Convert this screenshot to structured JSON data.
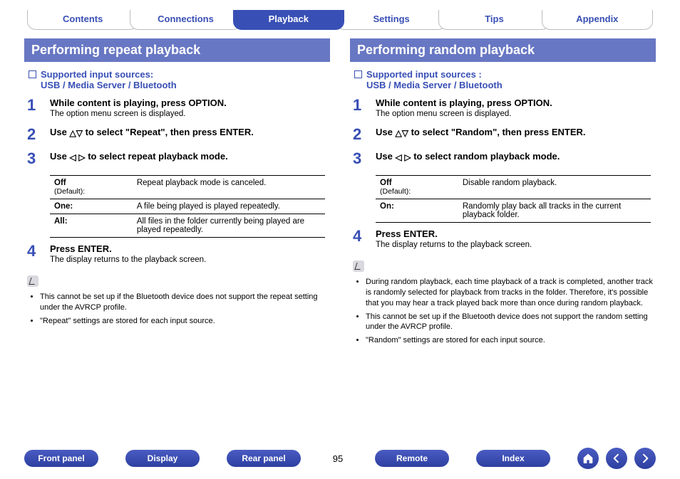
{
  "topnav": {
    "tabs": [
      {
        "label": "Contents",
        "active": false
      },
      {
        "label": "Connections",
        "active": false
      },
      {
        "label": "Playback",
        "active": true
      },
      {
        "label": "Settings",
        "active": false
      },
      {
        "label": "Tips",
        "active": false
      },
      {
        "label": "Appendix",
        "active": false
      }
    ]
  },
  "left": {
    "header": "Performing repeat playback",
    "sub": "Supported input sources:\nUSB / Media Server / Bluetooth",
    "steps": {
      "s1_title": "While content is playing, press OPTION.",
      "s1_note": "The option menu screen is displayed.",
      "s2_title_a": "Use ",
      "s2_title_b": " to select \"Repeat\", then press ENTER.",
      "s3_title_a": "Use ",
      "s3_title_b": " to select repeat playback mode.",
      "s4_title": "Press ENTER.",
      "s4_note": "The display returns to the playback screen."
    },
    "modes": [
      {
        "name": "Off",
        "default": "(Default):",
        "desc": "Repeat playback mode is canceled."
      },
      {
        "name": "One:",
        "default": "",
        "desc": "A file being played is played repeatedly."
      },
      {
        "name": "All:",
        "default": "",
        "desc": "All files in the folder currently being played are played repeatedly."
      }
    ],
    "notes": [
      "This cannot be set up if the Bluetooth device does not support the repeat setting under the AVRCP profile.",
      "\"Repeat\" settings are stored for each input source."
    ]
  },
  "right": {
    "header": "Performing random playback",
    "sub": "Supported input sources :\nUSB / Media Server / Bluetooth",
    "steps": {
      "s1_title": "While content is playing, press OPTION.",
      "s1_note": "The option menu screen is displayed.",
      "s2_title_a": "Use ",
      "s2_title_b": " to select \"Random\", then press ENTER.",
      "s3_title_a": "Use ",
      "s3_title_b": " to select random playback mode.",
      "s4_title": "Press ENTER.",
      "s4_note": "The display returns to the playback screen."
    },
    "modes": [
      {
        "name": "Off",
        "default": "(Default):",
        "desc": "Disable random playback."
      },
      {
        "name": "On:",
        "default": "",
        "desc": "Randomly play back all tracks in the current playback folder."
      }
    ],
    "notes": [
      "During random playback, each time playback of a track is completed, another track is randomly selected for playback from tracks in the folder. Therefore, it's possible that you may hear a track played back more than once during random playback.",
      "This cannot be set up if the Bluetooth device does not support the random setting under the AVRCP profile.",
      "\"Random\" settings are stored for each input source."
    ]
  },
  "bottomnav": {
    "pills": [
      "Front panel",
      "Display",
      "Rear panel",
      "Remote",
      "Index"
    ],
    "page": "95"
  }
}
